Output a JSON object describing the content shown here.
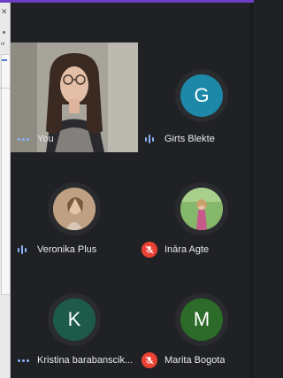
{
  "participants": [
    {
      "name": "You",
      "status": "dots"
    },
    {
      "name": "Girts Blekte",
      "initial": "G",
      "avatar_color": "#1e88a8",
      "status": "speaking"
    },
    {
      "name": "Veronika Plus",
      "status": "speaking"
    },
    {
      "name": "Ināra Agte",
      "status": "muted"
    },
    {
      "name": "Kristina barabanscik...",
      "initial": "K",
      "avatar_color": "#1e5a4a",
      "status": "dots"
    },
    {
      "name": "Marita Bogota",
      "initial": "M",
      "avatar_color": "#2d6b2a",
      "status": "muted"
    }
  ],
  "colors": {
    "background": "#202124",
    "accent_bar": "#6b3fc4",
    "speaking_blue": "#8ab4f8",
    "muted_red": "#ea4335"
  },
  "icons": [
    "more-dots-icon",
    "audio-bars-icon",
    "mic-off-icon",
    "close-icon"
  ]
}
